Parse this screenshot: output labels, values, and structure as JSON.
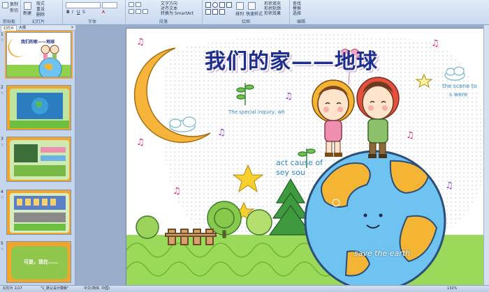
{
  "ribbon": {
    "clipboard": {
      "copy_label": "复制",
      "cut_label": "剪切",
      "group_label": "剪贴板"
    },
    "slides": {
      "new_label": "新建",
      "layout_label": "版式",
      "reset_label": "重设",
      "delete_label": "删除",
      "group_label": "幻灯片"
    },
    "font": {
      "group_label": "字体"
    },
    "paragraph": {
      "text_direction_label": "文字方向",
      "align_text_label": "对齐文本",
      "smartart_label": "转换为 SmartArt",
      "group_label": "段落"
    },
    "drawing": {
      "arrange_label": "排列",
      "quick_styles_label": "快速样式",
      "shape_fill_label": "形状填充",
      "shape_outline_label": "形状轮廓",
      "shape_effects_label": "形状效果",
      "group_label": "绘图"
    },
    "editing": {
      "find_label": "查找",
      "replace_label": "替换",
      "select_label": "选择",
      "group_label": "编辑"
    }
  },
  "panel": {
    "tab_slides": "幻灯片",
    "tab_outline": "大纲",
    "close": "×",
    "thumbnails": [
      {
        "number": "1",
        "mini_title": "我们的家——地球"
      },
      {
        "number": "2",
        "mini_title": ""
      },
      {
        "number": "3",
        "mini_title": ""
      },
      {
        "number": "4",
        "mini_title": ""
      },
      {
        "number": "5",
        "mini_title": "可是，现在……"
      }
    ]
  },
  "slide": {
    "title": "我们的家——地球",
    "bg_text_1": "The special inquiry, wh",
    "bg_text_2": "act cause of",
    "bg_text_3": "sey sou",
    "bg_text_4": "the scene to",
    "bg_text_5": "s were",
    "earth_caption": "save the earth",
    "music_note": "♫"
  },
  "status": {
    "slide_info": "幻灯片 1/17",
    "theme": "\"1_默认设计模板\"",
    "language": "中文(简体, 中国)",
    "zoom": "132%"
  },
  "colors": {
    "ribbon_bg": "#c8d8ee",
    "panel_bg": "#c4d5ec",
    "title": "#1f2f8e",
    "grass": "#8fd24a",
    "moon": "#f3a52a",
    "ocean": "#6ec3f0"
  }
}
